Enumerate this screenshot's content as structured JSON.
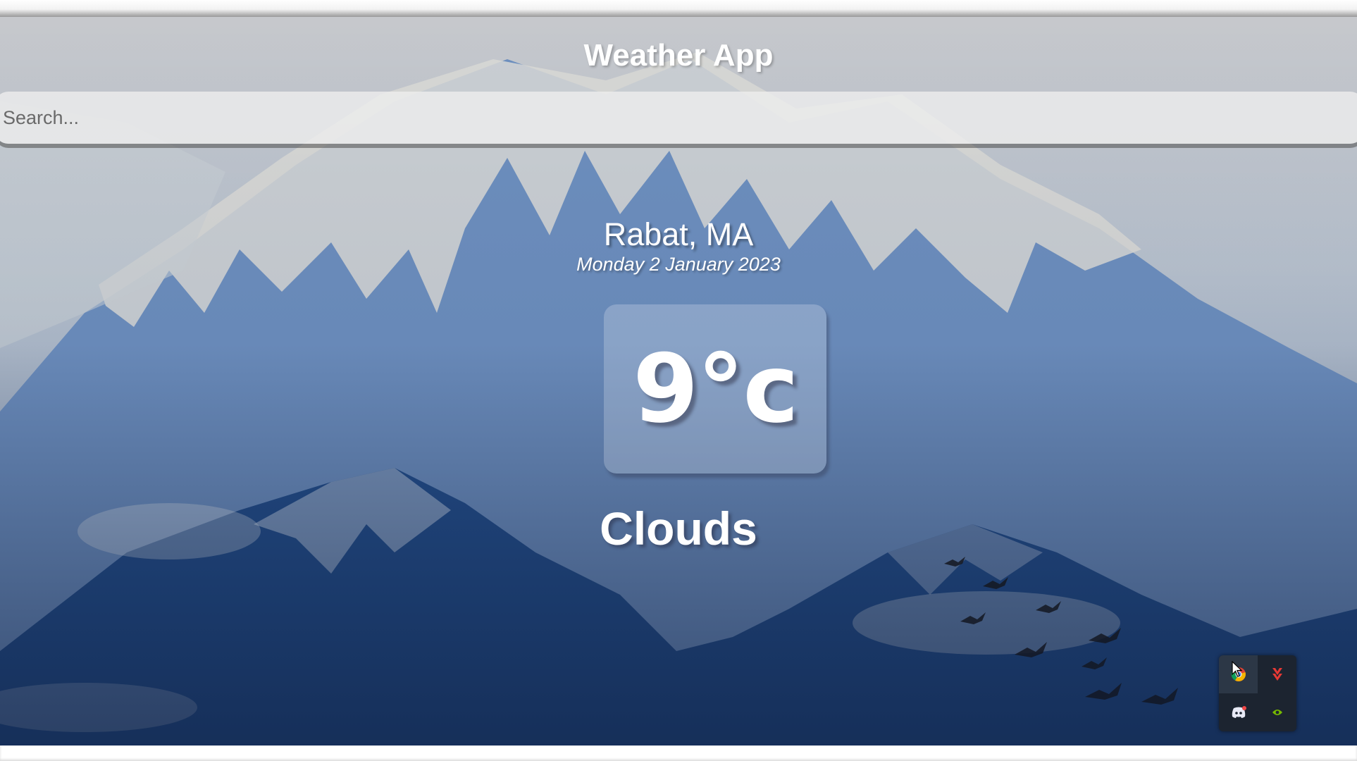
{
  "header": {
    "title": "Weather App"
  },
  "search": {
    "placeholder": "Search...",
    "value": ""
  },
  "location": {
    "city": "Rabat, MA",
    "date": "Monday 2 January 2023"
  },
  "weather": {
    "temperature": "9°c",
    "condition": "Clouds"
  },
  "system_tray": {
    "icons": [
      "chrome-icon",
      "download-manager-icon",
      "discord-icon",
      "nvidia-icon"
    ]
  },
  "colors": {
    "sky_top": "#c9ccd1",
    "mountain_blue": "#2f5c9a",
    "text": "#ffffff",
    "search_bg": "#eeeeee",
    "tray_bg": "#1c2430"
  }
}
